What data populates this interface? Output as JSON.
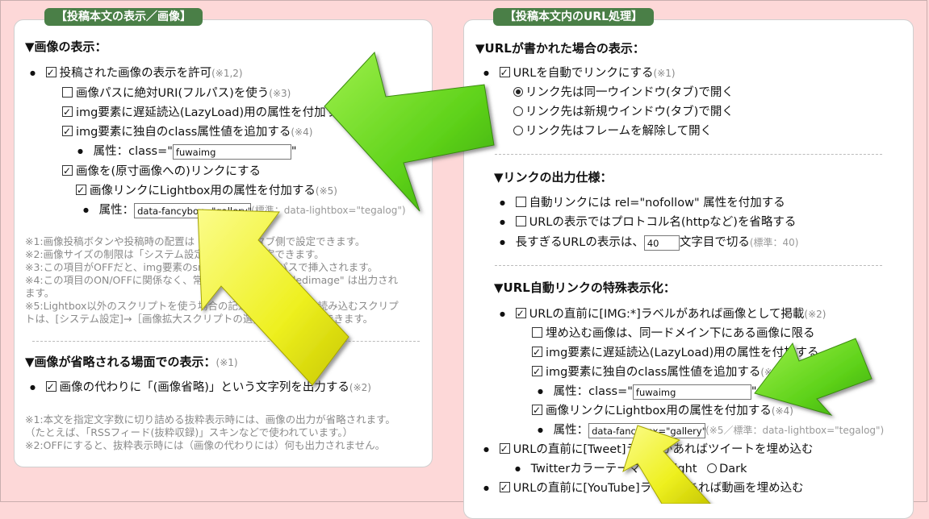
{
  "left": {
    "header": "【投稿本文の表示／画像】",
    "sec1_title": "▼画像の表示：",
    "opt_show_image": "投稿された画像の表示を許可",
    "opt_show_image_note": "(※1,2)",
    "opt_abs_uri": "画像パスに絶対URI(フルパス)を使う",
    "opt_abs_uri_note": "(※3)",
    "opt_lazy": "img要素に遅延読込(LazyLoad)用の属性を付加する",
    "opt_class": "img要素に独自のclass属性値を追加する",
    "opt_class_note": "(※4)",
    "attr_class_label": "属性：class=\"",
    "attr_class_value": "fuwaimg",
    "attr_class_close": "\"",
    "opt_link": "画像を(原寸画像への)リンクにする",
    "opt_lightbox": "画像リンクにLightbox用の属性を付加する",
    "opt_lightbox_note": "(※5)",
    "attr_lb_label": "属性：",
    "attr_lb_value": "data-fancybox=\"gallery\"",
    "attr_lb_note": "(標準：data-lightbox=\"tegalog\")",
    "notes1": [
      "※1:画像投稿ボタンや投稿時の配置は「投稿画面」タブ側で設定できます。",
      "※2:画像サイズの制限は「システム設定」タブ側で設定できます。",
      "※3:この項目がOFFだと、img要素のsrc属性値には相対パスで挿入されます。",
      "※4:この項目のON/OFFに関係なく、常に class=\"embeddedimage\" は出力され",
      "ます。",
      "※5:Lightbox以外のスクリプトを使う場合の記述にも使えます。読み込むスクリプ",
      "トは、[システム設定]→［画像拡大スクリプトの選択］の項で指定できます。"
    ],
    "sec2_title": "▼画像が省略される場面での表示：",
    "sec2_note": "(※1)",
    "opt_omit": "画像の代わりに「(画像省略)」という文字列を出力する",
    "opt_omit_note": "(※2)",
    "notes2": [
      "※1:本文を指定文字数に切り詰める抜粋表示時には、画像の出力が省略されます。",
      "（たとえば、「RSSフィード(抜粋収録)」スキンなどで使われています。）",
      "※2:OFFにすると、抜粋表示時には（画像の代わりには）何も出力されません。"
    ]
  },
  "right": {
    "header": "【投稿本文内のURL処理】",
    "sec1_title": "▼URLが書かれた場合の表示：",
    "opt_autolink": "URLを自動でリンクにする",
    "opt_autolink_note": "(※1)",
    "radio_same": "リンク先は同一ウインドウ(タブ)で開く",
    "radio_new": "リンク先は新規ウインドウ(タブ)で開く",
    "radio_frame": "リンク先はフレームを解除して開く",
    "sec2_title": "▼リンクの出力仕様：",
    "opt_nofollow": "自動リンクには rel=\"nofollow\" 属性を付加する",
    "opt_omit_proto": "URLの表示ではプロトコル名(httpなど)を省略する",
    "opt_cut_pre": "長すぎるURLの表示は、",
    "opt_cut_value": "40",
    "opt_cut_post": "文字目で切る",
    "opt_cut_note": "(標準：40)",
    "sec3_title": "▼URL自動リンクの特殊表示化：",
    "opt_img_label": "URLの直前に[IMG:*]ラベルがあれば画像として掲載",
    "opt_img_label_note": "(※2)",
    "opt_same_domain": "埋め込む画像は、同一ドメイン下にある画像に限る",
    "opt_lazy": "img要素に遅延読込(LazyLoad)用の属性を付加する",
    "opt_class": "img要素に独自のclass属性値を追加する",
    "opt_class_note": "(※3)",
    "attr_class_label": "属性：class=\"",
    "attr_class_value": "fuwaimg",
    "attr_class_close": "\"",
    "opt_lightbox": "画像リンクにLightbox用の属性を付加する",
    "opt_lightbox_note": "(※4)",
    "attr_lb_label": "属性：",
    "attr_lb_value": "data-fancybox=\"gallery\"",
    "attr_lb_note": "(※5／標準：data-lightbox=\"tegalog\")",
    "opt_tweet": "URLの直前に[Tweet]ラベルがあればツイートを埋め込む",
    "twitter_theme_label": "Twitterカラーテーマ：",
    "theme_light": "Light",
    "theme_dark": "Dark",
    "opt_youtube": "URLの直前に[YouTube]ラベルがあれば動画を埋め込む"
  },
  "colors": {
    "background": "#fdd8d8",
    "header": "#4a7f47",
    "arrow_green": "#5ed21a",
    "arrow_yellow": "#eef020"
  }
}
